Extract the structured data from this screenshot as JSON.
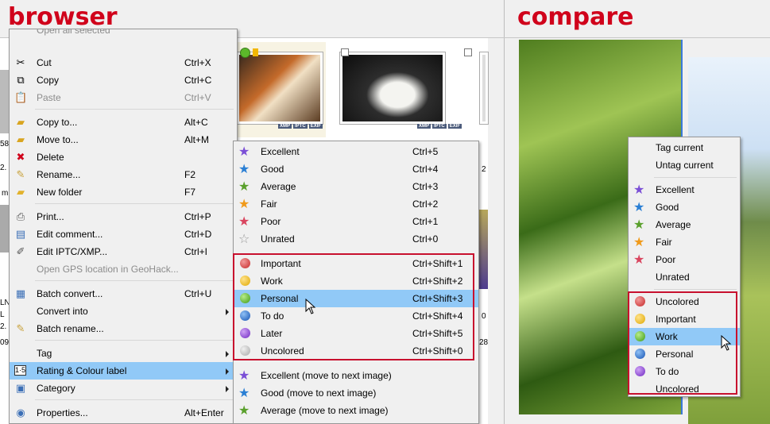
{
  "titles": {
    "browser": "browser",
    "compare": "compare"
  },
  "colors": {
    "title_red": "#d0021b",
    "highlight": "#91c9f7",
    "redbox": "#c8102e"
  },
  "context_menu": {
    "cut_off_item": "Open all selected",
    "items": [
      {
        "label": "Cut",
        "shortcut": "Ctrl+X",
        "icon": "scissors-icon"
      },
      {
        "label": "Copy",
        "shortcut": "Ctrl+C",
        "icon": "copy-icon"
      },
      {
        "label": "Paste",
        "shortcut": "Ctrl+V",
        "icon": "paste-icon",
        "disabled": true
      },
      {
        "label": "Copy to...",
        "shortcut": "Alt+C",
        "icon": "copy-to-folder-icon"
      },
      {
        "label": "Move to...",
        "shortcut": "Alt+M",
        "icon": "move-to-folder-icon"
      },
      {
        "label": "Delete",
        "shortcut": "",
        "icon": "delete-icon"
      },
      {
        "label": "Rename...",
        "shortcut": "F2",
        "icon": "rename-icon"
      },
      {
        "label": "New folder",
        "shortcut": "F7",
        "icon": "new-folder-icon"
      },
      {
        "label": "Print...",
        "shortcut": "Ctrl+P",
        "icon": "printer-icon"
      },
      {
        "label": "Edit comment...",
        "shortcut": "Ctrl+D",
        "icon": "comment-icon"
      },
      {
        "label": "Edit IPTC/XMP...",
        "shortcut": "Ctrl+I",
        "icon": "iptc-icon"
      },
      {
        "label": "Open GPS location in GeoHack...",
        "shortcut": "",
        "icon": "",
        "disabled": true
      },
      {
        "label": "Batch convert...",
        "shortcut": "Ctrl+U",
        "icon": "batch-convert-icon"
      },
      {
        "label": "Convert into",
        "shortcut": "",
        "icon": "",
        "submenu": true
      },
      {
        "label": "Batch rename...",
        "shortcut": "",
        "icon": "batch-rename-icon"
      },
      {
        "label": "Tag",
        "shortcut": "",
        "icon": "",
        "submenu": true
      },
      {
        "label": "Rating & Colour label",
        "shortcut": "",
        "icon": "rating-icon",
        "submenu": true,
        "highlighted": true
      },
      {
        "label": "Category",
        "shortcut": "",
        "icon": "category-icon",
        "submenu": true
      },
      {
        "label": "Properties...",
        "shortcut": "Alt+Enter",
        "icon": "properties-icon"
      }
    ]
  },
  "rating_submenu": {
    "ratings": [
      {
        "label": "Excellent",
        "shortcut": "Ctrl+5",
        "color": "#7b4fd6"
      },
      {
        "label": "Good",
        "shortcut": "Ctrl+4",
        "color": "#2a7fd4"
      },
      {
        "label": "Average",
        "shortcut": "Ctrl+3",
        "color": "#5aa02c"
      },
      {
        "label": "Fair",
        "shortcut": "Ctrl+2",
        "color": "#f09a1a"
      },
      {
        "label": "Poor",
        "shortcut": "Ctrl+1",
        "color": "#d9455f"
      },
      {
        "label": "Unrated",
        "shortcut": "Ctrl+0",
        "color": "#ffffff"
      }
    ],
    "labels": [
      {
        "label": "Important",
        "shortcut": "Ctrl+Shift+1",
        "color": "#d63a3a"
      },
      {
        "label": "Work",
        "shortcut": "Ctrl+Shift+2",
        "color": "#f2b705"
      },
      {
        "label": "Personal",
        "shortcut": "Ctrl+Shift+3",
        "color": "#5cb82a",
        "highlighted": true
      },
      {
        "label": "To do",
        "shortcut": "Ctrl+Shift+4",
        "color": "#1f6fd1"
      },
      {
        "label": "Later",
        "shortcut": "Ctrl+Shift+5",
        "color": "#8a3fd6"
      },
      {
        "label": "Uncolored",
        "shortcut": "Ctrl+Shift+0",
        "color": "#bdbdbd"
      }
    ],
    "move_next": [
      {
        "label": "Excellent (move to next image)",
        "color": "#7b4fd6"
      },
      {
        "label": "Good (move to next image)",
        "color": "#2a7fd4"
      },
      {
        "label": "Average (move to next image)",
        "color": "#5aa02c"
      }
    ]
  },
  "compare_menu": {
    "tag_items": [
      "Tag current",
      "Untag current"
    ],
    "ratings": [
      {
        "label": "Excellent",
        "color": "#7b4fd6"
      },
      {
        "label": "Good",
        "color": "#2a7fd4"
      },
      {
        "label": "Average",
        "color": "#5aa02c"
      },
      {
        "label": "Fair",
        "color": "#f09a1a"
      },
      {
        "label": "Poor",
        "color": "#d9455f"
      },
      {
        "label": "Unrated",
        "color": ""
      }
    ],
    "labels": [
      {
        "label": "Uncolored",
        "color": "#d63a3a"
      },
      {
        "label": "Important",
        "color": "#f2b705"
      },
      {
        "label": "Work",
        "color": "#5cb82a",
        "highlighted": true
      },
      {
        "label": "Personal",
        "color": "#1f6fd1"
      },
      {
        "label": "To do",
        "color": "#8a3fd6"
      },
      {
        "label": "Uncolored",
        "color": ""
      }
    ]
  },
  "thumbnail_badges": [
    "XMP",
    "IPTC",
    "EXIF"
  ],
  "left_edge_fragments": [
    "58",
    "2.",
    "m",
    "LN",
    "L",
    "2.",
    "09"
  ],
  "right_edge_fragments": [
    "2",
    "0",
    "28"
  ]
}
